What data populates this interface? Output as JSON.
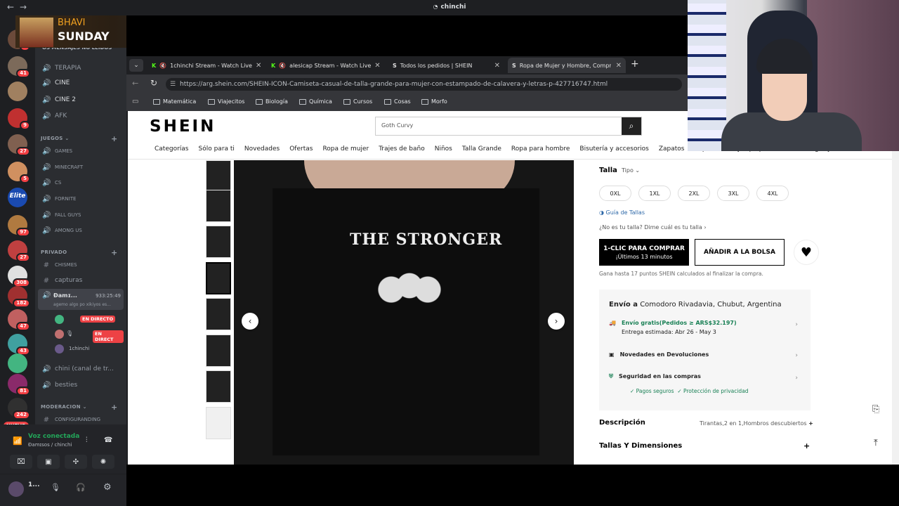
{
  "window": {
    "title": "chinchi",
    "nav_back": "←",
    "nav_forward": "→"
  },
  "banner": {
    "line1": "BHAVI",
    "line2": "SUNDAY"
  },
  "servers": [
    {
      "badge": "2",
      "color": "#6b4a3a"
    },
    {
      "badge": "41",
      "color": "#7c6a5a"
    },
    {
      "badge": "",
      "color": "#a08060"
    },
    {
      "badge": "9",
      "color": "#c03030"
    },
    {
      "badge": "27",
      "color": "#806050"
    },
    {
      "badge": "5",
      "color": "#d09060"
    },
    {
      "badge": "",
      "color": "#1a4ab0",
      "label": "Elite"
    },
    {
      "badge": "97",
      "color": "#b07a40"
    },
    {
      "badge": "27",
      "color": "#c04040"
    },
    {
      "badge": "308",
      "color": "#e0e0e0"
    },
    {
      "badge": "182",
      "color": "#a03030"
    },
    {
      "badge": "47",
      "color": "#c06060"
    },
    {
      "badge": "43",
      "color": "#40a0a0"
    },
    {
      "badge": "",
      "color": "#43b581"
    },
    {
      "badge": "81",
      "color": "#8a2a6a"
    },
    {
      "badge": "242",
      "color": "#303030"
    },
    {
      "badge": "",
      "color": "#555",
      "label": "NUEVO"
    }
  ],
  "channels": {
    "unread_hint": "OS MENSAJES NO LEIDOS",
    "voice_top": [
      "TERAPIA",
      "CINE",
      "CINE 2",
      "AFK"
    ],
    "cat_juegos": "JUEGOS",
    "juegos": [
      "GAMES",
      "MINECRAFT",
      "CS",
      "FORNITE",
      "FALL GUYS",
      "AMONG US"
    ],
    "cat_privado": "PRIVADO",
    "privado": [
      "CHISMES",
      "capturas"
    ],
    "active_call": {
      "name": "Ɖamɪ...",
      "time": "933:25:49",
      "status": "agemo algo po xikiyos es..."
    },
    "participants": [
      {
        "name": "",
        "live": "EN DIRECTO"
      },
      {
        "name": "",
        "live": "EN DIRECT"
      },
      {
        "name": "1chinchi",
        "live": ""
      }
    ],
    "more": [
      "chini (canal de tr...",
      "besties"
    ],
    "cat_moderacion": "MODERACION",
    "moderacion": [
      "CONFIGURANDING"
    ]
  },
  "voice_panel": {
    "status": "Voz conectada",
    "server": "Ɖamɪsos / chinchi",
    "user": "1..."
  },
  "tabs": [
    {
      "label": "1chinchi Stream - Watch Live",
      "active": false
    },
    {
      "label": "alesicap Stream - Watch Live",
      "active": false
    },
    {
      "label": "Todos los pedidos | SHEIN",
      "active": false
    },
    {
      "label": "Ropa de Mujer y Hombre, Compra",
      "active": true
    }
  ],
  "address": {
    "url": "https://arg.shein.com/SHEIN-ICON-Camiseta-casual-de-talla-grande-para-mujer-con-estampado-de-calavera-y-letras-p-427716747.html"
  },
  "bookmarks": [
    "Matemática",
    "Viajecitos",
    "Biología",
    "Química",
    "Cursos",
    "Cosas",
    "Morfo"
  ],
  "shein": {
    "logo": "SHEIN",
    "search_value": "Goth Curvy",
    "nav": [
      "Categorías",
      "Sólo para ti",
      "Novedades",
      "Ofertas",
      "Ropa de mujer",
      "Trajes de baño",
      "Niños",
      "Talla Grande",
      "Ropa para hombre",
      "Bisutería y accesorios",
      "Zapatos",
      "Ropa interior y ropa para dormir",
      "Hogar y Vida"
    ],
    "size_label": "Talla",
    "size_type": "Tipo",
    "sizes": [
      "0XL",
      "1XL",
      "2XL",
      "3XL",
      "4XL"
    ],
    "size_guide": "Guía de Tallas",
    "size_hint": "¿No es tu talla? Dime cuál es tu talla",
    "buy_now": "1-CLIC PARA COMPRAR",
    "buy_now_sub": "¡Últimos 13 minutos",
    "add_bag": "AÑADIR A LA BOLSA",
    "points": "Gana hasta 17 puntos SHEIN calculados al finalizar la compra.",
    "ship_to_label": "Envío a",
    "ship_to": "Comodoro Rivadavia, Chubut, Argentina",
    "free_ship": "Envío gratis(Pedidos ≥ ARS$32.197)",
    "eta": "Entrega estimada: Abr 26 - May 3",
    "returns": "Novedades en Devoluciones",
    "security": "Seguridad en las compras",
    "secure_pay": "✓ Pagos seguros",
    "privacy": "✓ Protección de privacidad",
    "desc_label": "Descripción",
    "desc_value": "Tirantas,2 en 1,Hombros descubiertos",
    "sizes_dims": "Tallas Y Dimensiones",
    "shirt_text": "THE STRONGER"
  }
}
